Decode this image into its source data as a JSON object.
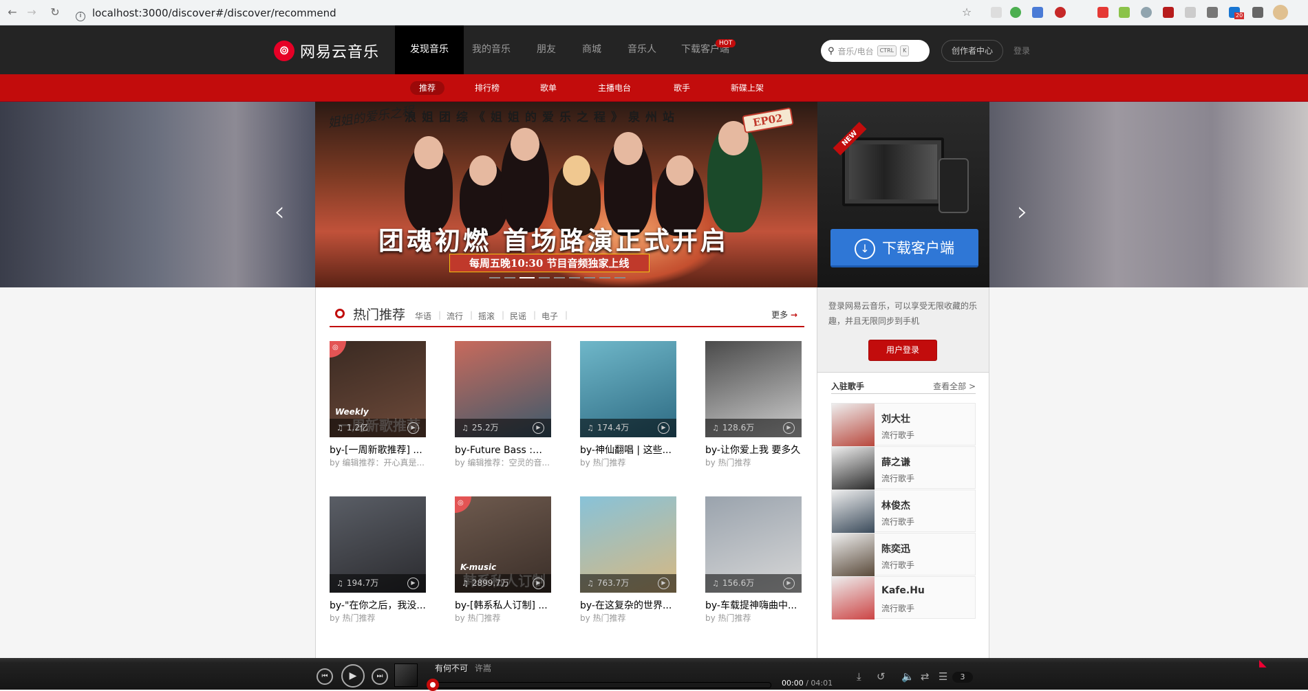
{
  "browser": {
    "url": "localhost:3000/discover#/discover/recommend",
    "ext_badge": "20"
  },
  "header": {
    "logo_text": "网易云音乐",
    "nav": [
      "发现音乐",
      "我的音乐",
      "朋友",
      "商城",
      "音乐人",
      "下载客户端"
    ],
    "hot_badge": "HOT",
    "search_placeholder": "音乐/电台",
    "kbd1": "CTRL",
    "kbd2": "K",
    "creator": "创作者中心",
    "login": "登录"
  },
  "subnav": [
    "推荐",
    "排行榜",
    "歌单",
    "主播电台",
    "歌手",
    "新碟上架"
  ],
  "banner": {
    "brand": "姐姐的爱乐之程",
    "title": "浪姐团综《姐姐的爱乐之程》泉州站",
    "ep": "EP02",
    "headline": "团魂初燃  首场路演正式开启",
    "subline": "每周五晚10:30  节目音频独家上线",
    "new_tag": "NEW",
    "download_btn": "下载客户端",
    "prev": "‹",
    "next": "›"
  },
  "hot": {
    "title": "热门推荐",
    "tags": [
      "华语",
      "流行",
      "摇滚",
      "民谣",
      "电子"
    ],
    "more": "更多",
    "cards": [
      {
        "count": "1.2亿",
        "name": "by-[一周新歌推荐] ...",
        "by": "by 编辑推荐：开心真是...",
        "tag": "Weekly",
        "over": "一周新歌推荐",
        "colors": [
          "#3a2a22",
          "#6e4a3a"
        ]
      },
      {
        "count": "25.2万",
        "name": "by-Future Bass :炫...",
        "by": "by 编辑推荐：空灵的音...",
        "tag": "",
        "over": "",
        "colors": [
          "#c86a5c",
          "#3c5a6c"
        ]
      },
      {
        "count": "174.4万",
        "name": "by-神仙翻唱 | 这些...",
        "by": "by 热门推荐",
        "tag": "",
        "over": "",
        "colors": [
          "#6fb7c9",
          "#2d6a82"
        ]
      },
      {
        "count": "128.6万",
        "name": "by-让你爱上我 要多久",
        "by": "by 热门推荐",
        "tag": "",
        "over": "",
        "colors": [
          "#4a4a4a",
          "#cfcfcf"
        ]
      },
      {
        "count": "194.7万",
        "name": "by-\"在你之后，我没...",
        "by": "by 热门推荐",
        "tag": "",
        "over": "",
        "colors": [
          "#5a5e66",
          "#2a2a2e"
        ]
      },
      {
        "count": "2899.7万",
        "name": "by-[韩系私人订制] ...",
        "by": "by 热门推荐",
        "tag": "K-music",
        "over": "韩系私人订制",
        "colors": [
          "#6e5a4e",
          "#3a2e28"
        ]
      },
      {
        "count": "763.7万",
        "name": "by-在这复杂的世界...",
        "by": "by 热门推荐",
        "tag": "",
        "over": "",
        "colors": [
          "#88c2d8",
          "#d8b880"
        ]
      },
      {
        "count": "156.6万",
        "name": "by-车载提神嗨曲中...",
        "by": "by 热门推荐",
        "tag": "",
        "over": "",
        "colors": [
          "#9aa3ad",
          "#d8d8d8"
        ]
      }
    ]
  },
  "login_box": {
    "desc": "登录网易云音乐，可以享受无限收藏的乐趣，并且无限同步到手机",
    "button": "用户登录"
  },
  "singers": {
    "title": "入驻歌手",
    "all": "查看全部 >",
    "list": [
      {
        "name": "刘大壮",
        "desc": "流行歌手",
        "color": "#b8473c"
      },
      {
        "name": "薛之谦",
        "desc": "流行歌手",
        "color": "#2a2a2a"
      },
      {
        "name": "林俊杰",
        "desc": "流行歌手",
        "color": "#3a4a5a"
      },
      {
        "name": "陈奕迅",
        "desc": "流行歌手",
        "color": "#5a4a3a"
      },
      {
        "name": "Kafe.Hu",
        "desc": "流行歌手",
        "color": "#c44"
      }
    ]
  },
  "player": {
    "song": "有何不可",
    "artist": "许嵩",
    "current": "00:00",
    "duration": "04:01",
    "progress": 0,
    "playlist_count": "3"
  }
}
